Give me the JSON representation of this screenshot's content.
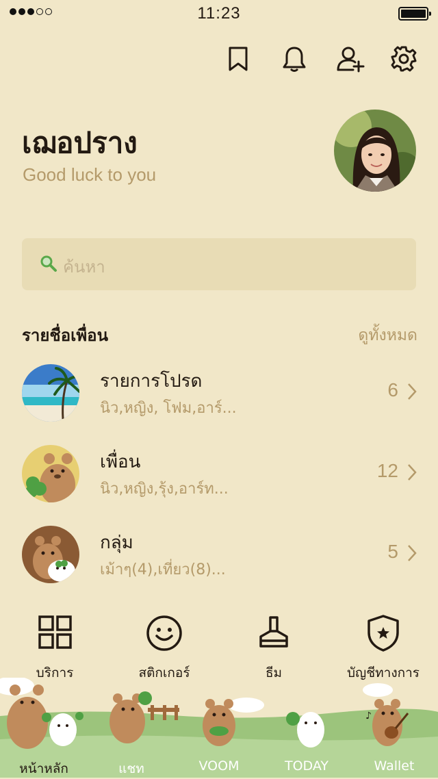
{
  "status_bar": {
    "time": "11:23",
    "signal_bars": 5,
    "signal_filled": 3
  },
  "header": {
    "icons": [
      "bookmark-icon",
      "bell-icon",
      "add-friend-icon",
      "gear-icon"
    ]
  },
  "profile": {
    "name": "เฌอปราง",
    "status_message": "Good luck to you"
  },
  "search": {
    "placeholder": "ค้นหา"
  },
  "friends_section": {
    "title": "รายชื่อเพื่อน",
    "see_all": "ดูทั้งหมด",
    "rows": [
      {
        "title": "รายการโปรด",
        "subtitle": "นิว,หญิง, โฟม,อาร์...",
        "count": "6"
      },
      {
        "title": "เพื่อน",
        "subtitle": "นิว,หญิง,รุ้ง,อาร์ท...",
        "count": "12"
      },
      {
        "title": "กลุ่ม",
        "subtitle": "เม้าๆ(4),เที่ยว(8)...",
        "count": "5"
      }
    ]
  },
  "services": [
    {
      "label": "บริการ",
      "icon": "grid-icon"
    },
    {
      "label": "สติกเกอร์",
      "icon": "smile-icon"
    },
    {
      "label": "ธีม",
      "icon": "brush-icon"
    },
    {
      "label": "บัญชีทางการ",
      "icon": "shield-star-icon"
    }
  ],
  "tab_bar": {
    "tabs": [
      {
        "label": "หน้าหลัก",
        "active": true
      },
      {
        "label": "แชท",
        "active": false
      },
      {
        "label": "VOOM",
        "active": false
      },
      {
        "label": "TODAY",
        "active": false
      },
      {
        "label": "Wallet",
        "active": false
      }
    ]
  },
  "colors": {
    "background": "#f1e7c8",
    "accent_text": "#b49a6a",
    "search_bg": "#e8dcb5",
    "grass": "#9cc47c"
  }
}
